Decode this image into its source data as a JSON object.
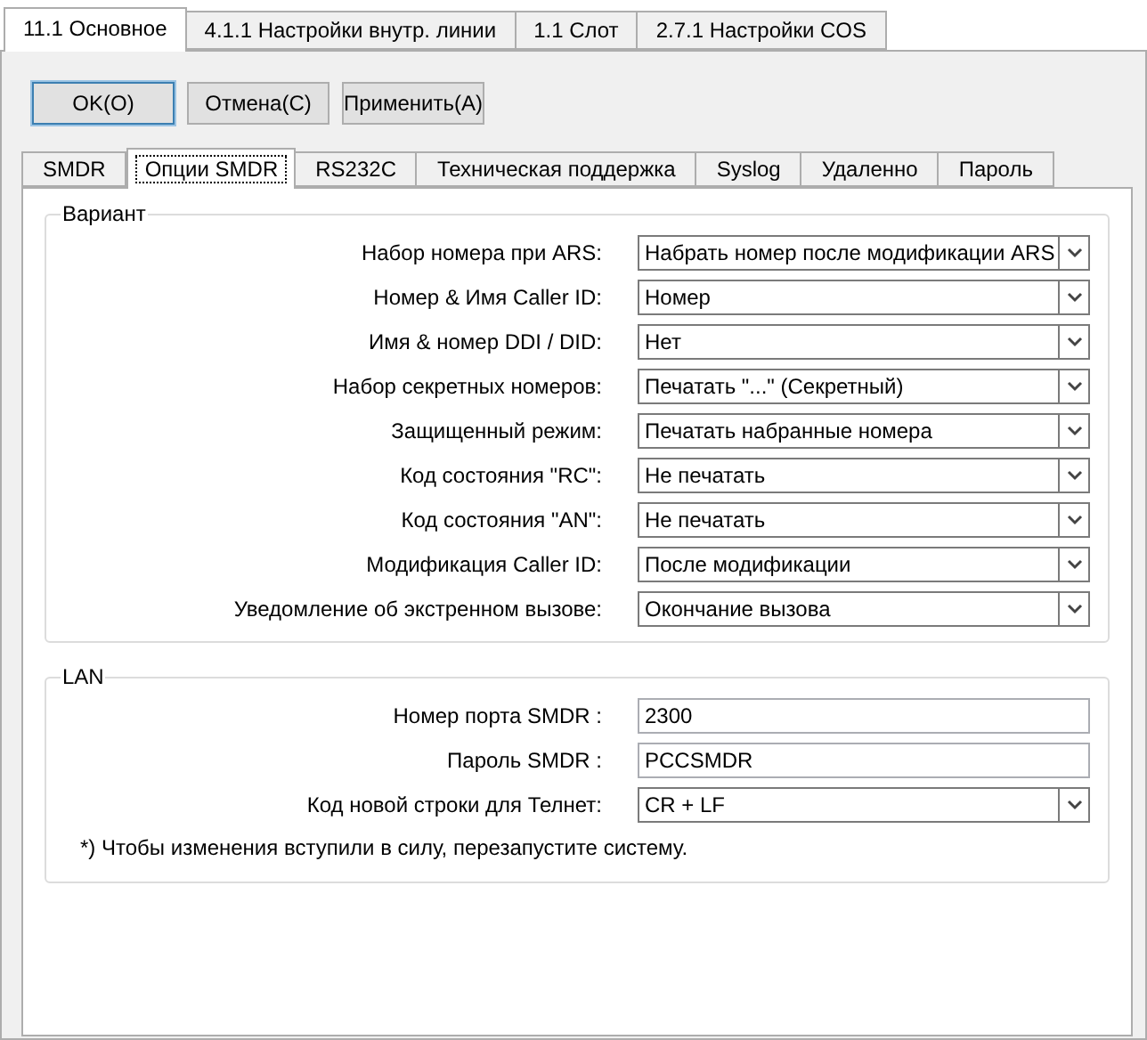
{
  "top_tabs": [
    {
      "label": "11.1 Основное",
      "selected": true
    },
    {
      "label": "4.1.1 Настройки внутр. линии",
      "selected": false
    },
    {
      "label": "1.1 Слот",
      "selected": false
    },
    {
      "label": "2.7.1 Настройки COS",
      "selected": false
    }
  ],
  "buttons": [
    {
      "label": "OK(O)",
      "kind": "default"
    },
    {
      "label": "Отмена(C)",
      "kind": "normal"
    },
    {
      "label": "Применить(A)",
      "kind": "normal"
    }
  ],
  "tabs": [
    {
      "label": "SMDR",
      "selected": false
    },
    {
      "label": "Опции SMDR",
      "selected": true
    },
    {
      "label": "RS232C",
      "selected": false
    },
    {
      "label": "Техническая поддержка",
      "selected": false
    },
    {
      "label": "Syslog",
      "selected": false
    },
    {
      "label": "Удаленно",
      "selected": false
    },
    {
      "label": "Пароль",
      "selected": false
    }
  ],
  "groups": [
    {
      "title": "Вариант",
      "fields": [
        {
          "label": "Набор номера при ARS:",
          "kind": "select",
          "value": "Набрать номер после модификации ARS"
        },
        {
          "label": "Номер & Имя Caller ID:",
          "kind": "select",
          "value": "Номер"
        },
        {
          "label": "Имя & номер DDI / DID:",
          "kind": "select",
          "value": "Нет"
        },
        {
          "label": "Набор секретных номеров:",
          "kind": "select",
          "value": "Печатать \"...\" (Секретный)"
        },
        {
          "label": "Защищенный режим:",
          "kind": "select",
          "value": "Печатать набранные номера"
        },
        {
          "label": "Код состояния \"RC\":",
          "kind": "select",
          "value": "Не печатать"
        },
        {
          "label": "Код состояния \"AN\":",
          "kind": "select",
          "value": "Не печатать"
        },
        {
          "label": "Модификация Caller ID:",
          "kind": "select",
          "value": "После модификации"
        },
        {
          "label": "Уведомление об экстренном вызове:",
          "kind": "select",
          "value": "Окончание вызова"
        }
      ]
    },
    {
      "title": "LAN",
      "fields": [
        {
          "label": "Номер порта SMDR :",
          "kind": "text",
          "value": "2300"
        },
        {
          "label": "Пароль SMDR :",
          "kind": "text",
          "value": "PCCSMDR"
        },
        {
          "label": "Код новой строки для Телнет:",
          "kind": "select",
          "value": "CR + LF"
        }
      ],
      "note": "*) Чтобы изменения вступили в силу, перезапустите систему."
    }
  ]
}
